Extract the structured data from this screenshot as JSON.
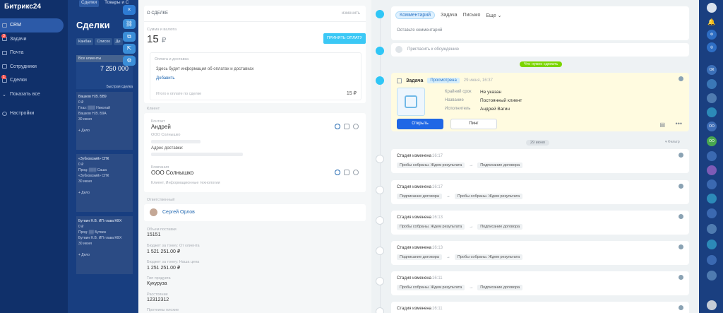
{
  "app": {
    "logo": "Битрикс24"
  },
  "sidebar": {
    "items": [
      {
        "label": "CRM",
        "badge": "",
        "active": true
      },
      {
        "label": "Задачи",
        "badge": "3",
        "active": false
      },
      {
        "label": "Почта",
        "badge": "",
        "active": false
      },
      {
        "label": "Сотрудники",
        "badge": "",
        "active": false
      },
      {
        "label": "Сделки",
        "badge": "1",
        "active": false
      },
      {
        "label": "Показать все",
        "badge": "",
        "active": false
      },
      {
        "label": "Настройки",
        "badge": "",
        "active": false
      }
    ]
  },
  "crm": {
    "tabs": [
      "Сделки",
      "Товары и С"
    ],
    "title": "Сделки",
    "views": [
      "Канбан",
      "Список",
      "Де"
    ],
    "column": {
      "header": "Все клиенты",
      "sum": "7 250 000",
      "quick": "Быстрая сделка"
    },
    "cards": [
      {
        "title": "Вашков Н.В. БВ9",
        "amount": "0 ₽",
        "line1": "Глаз: ▒▒▒ Николай",
        "line2": "Вашков Н.В. Б9А",
        "tag": "30 июня",
        "foot": "+ Дело"
      },
      {
        "title": "«Зубковский» СПК",
        "amount": "0 ₽",
        "line1": "Прод: ▒▒▒ Саша",
        "line2": "«Зубковский» СПК",
        "tag": "30 июня",
        "foot": "+ Дело"
      },
      {
        "title": "Бутвин Н.В. ИП глава КФХ",
        "amount": "0 ₽",
        "line1": "Прод: ▒▒ Бутвин",
        "line2": "Бутвин Н.В. ИП глава КФХ",
        "tag": "30 июня",
        "foot": "+ Дело"
      }
    ]
  },
  "controls": {
    "close": "×"
  },
  "deal": {
    "section_title": "О СДЕЛКЕ",
    "edit": "изменить",
    "sum_label": "Сумма и валюта",
    "sum_value": "15",
    "currency": "₽",
    "pay_button": "ПРИНЯТЬ ОПЛАТУ",
    "payment": {
      "title": "Оплата и доставка",
      "info": "Здесь будет информация об оплатах и доставках",
      "add": "Добавить",
      "total_label": "Итого к оплате по сделке",
      "total_value": "15 ₽"
    },
    "client_label": "Клиент",
    "contact": {
      "label": "Контакт",
      "name": "Андрей",
      "company": "ООО Солнышко",
      "address_label": "Адрес доставки:"
    },
    "company": {
      "label": "Компания",
      "name": "ООО Солнышко",
      "industry": "Клиент, Информационные технологии"
    },
    "responsible_label": "Ответственный",
    "responsible_name": "Сергей Орлов",
    "fields": [
      {
        "label": "Объем поставки",
        "value": "15151"
      },
      {
        "label": "Бюджет за тонну: От клиента",
        "value": "1 521 251.00 ₽"
      },
      {
        "label": "Бюджет за тонну: Наша цена",
        "value": "1 251 251.00 ₽"
      },
      {
        "label": "Тип продукта",
        "value": "Кукуруза"
      },
      {
        "label": "Расстояние",
        "value": "12312312"
      },
      {
        "label": "Протеины плохие",
        "value": ""
      }
    ]
  },
  "timeline": {
    "tabs": [
      "Комментарий",
      "Задача",
      "Письмо",
      "Еще"
    ],
    "comment_placeholder": "Оставьте комментарий",
    "invite_text": "Пригласить к обсуждению",
    "todo_badge": "Что нужно сделать",
    "task": {
      "type": "Задача",
      "status": "Просмотрена",
      "time": "29 июня, 16:37",
      "rows": [
        {
          "label": "Крайний срок",
          "value": "Не указан",
          "link": false
        },
        {
          "label": "Название",
          "value": "Постоянный клиент",
          "link": true
        },
        {
          "label": "Исполнитель",
          "value": "Андрей Вагин",
          "link": true
        }
      ],
      "open": "Открыть",
      "ping": "Пинг"
    },
    "date_pill": "29 июня",
    "filter": "Фильтр",
    "events": [
      {
        "title": "Стадия изменена",
        "time": "16:17",
        "from": "Пробы собраны. Ждем результата",
        "to": "Подписание договора"
      },
      {
        "title": "Стадия изменена",
        "time": "16:17",
        "from": "Подписание договора",
        "to": "Пробы собраны. Ждем результата"
      },
      {
        "title": "Стадия изменена",
        "time": "16:13",
        "from": "Пробы собраны. Ждем результата",
        "to": "Подписание договора"
      },
      {
        "title": "Стадия изменена",
        "time": "16:13",
        "from": "Подписание договора",
        "to": "Пробы собраны. Ждем результата"
      },
      {
        "title": "Стадия изменена",
        "time": "16:11",
        "from": "Пробы собраны. Ждем результата",
        "to": "Подписание договора"
      },
      {
        "title": "Стадия изменена",
        "time": "16:11",
        "from": "",
        "to": ""
      }
    ]
  },
  "dock": {
    "badges": [
      "ОК",
      "ОО",
      "ОО"
    ]
  }
}
